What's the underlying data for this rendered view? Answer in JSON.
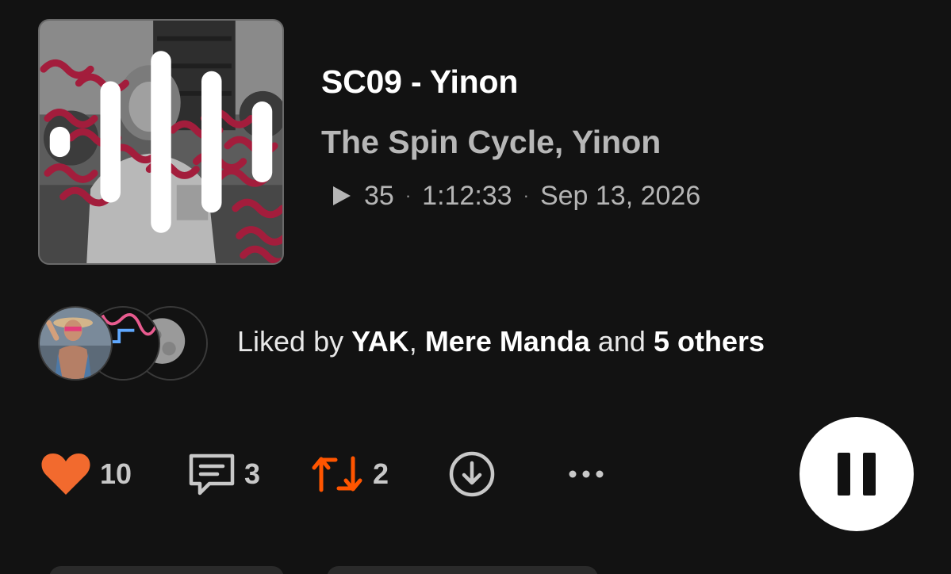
{
  "track": {
    "title": "SC09 - Yinon",
    "artists": "The Spin Cycle, Yinon",
    "plays": "35",
    "duration": "1:12:33",
    "date": "Sep 13, 2026",
    "separator": "·"
  },
  "liked_by": {
    "prefix": "Liked by ",
    "user1": "YAK",
    "comma": ", ",
    "user2": "Mere Manda",
    "middle": " and ",
    "others": "5 others"
  },
  "actions": {
    "likes": "10",
    "comments": "3",
    "reposts": "2"
  },
  "icons": {
    "artwork_overlay": "waveform-icon",
    "meta": "play-icon",
    "like": "heart-icon",
    "comment": "comment-icon",
    "repost": "repost-icon",
    "download": "download-icon",
    "more": "more-icon",
    "player": "pause-icon"
  },
  "colors": {
    "background": "#121212",
    "accent": "#ff5500",
    "heart": "#f26a2e",
    "text_secondary": "#b7b7b7"
  }
}
